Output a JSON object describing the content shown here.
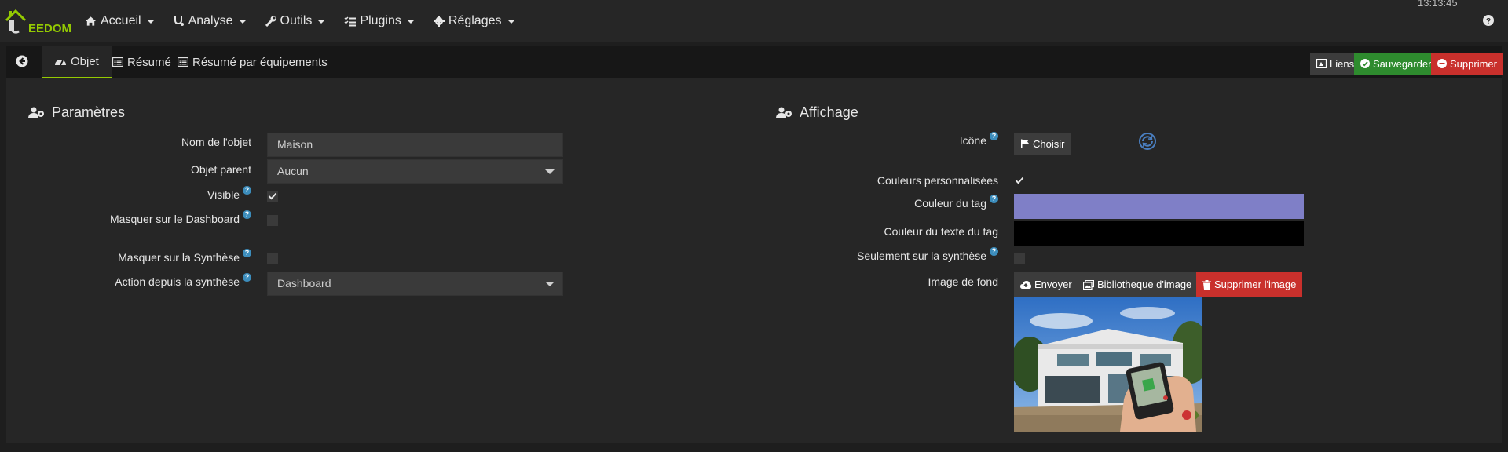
{
  "nav": {
    "logo_text": "EEDOM",
    "clock": "13:13:45",
    "items": [
      {
        "label": "Accueil",
        "icon": "home-icon"
      },
      {
        "label": "Analyse",
        "icon": "stethoscope-icon"
      },
      {
        "label": "Outils",
        "icon": "wrench-icon"
      },
      {
        "label": "Plugins",
        "icon": "tasks-icon"
      },
      {
        "label": "Réglages",
        "icon": "cog-icon"
      }
    ]
  },
  "tabs": {
    "objet": "Objet",
    "resume": "Résumé",
    "resume_equip": "Résumé par équipements"
  },
  "actions": {
    "liens": "Liens",
    "sauvegarder": "Sauvegarder",
    "supprimer": "Supprimer"
  },
  "params": {
    "title": "Paramètres",
    "nom_label": "Nom de l'objet",
    "nom_value": "Maison",
    "parent_label": "Objet parent",
    "parent_value": "Aucun",
    "visible_label": "Visible",
    "visible_checked": true,
    "masquer_dashboard_label": "Masquer sur le Dashboard",
    "masquer_dashboard_checked": false,
    "masquer_synthese_label": "Masquer sur la Synthèse",
    "masquer_synthese_checked": false,
    "action_label": "Action depuis la synthèse",
    "action_value": "Dashboard"
  },
  "affichage": {
    "title": "Affichage",
    "icone_label": "Icône",
    "choisir_label": "Choisir",
    "couleurs_label": "Couleurs personnalisées",
    "couleurs_checked": true,
    "couleur_tag_label": "Couleur du tag",
    "couleur_tag_value": "#7f7fc7",
    "couleur_texte_label": "Couleur du texte du tag",
    "couleur_texte_value": "#000000",
    "seulement_label": "Seulement sur la synthèse",
    "seulement_checked": false,
    "image_label": "Image de fond",
    "envoyer_label": "Envoyer",
    "bibliotheque_label": "Bibliotheque d'image",
    "supprimer_image_label": "Supprimer l'image"
  },
  "colors": {
    "accent": "#94ca02",
    "success": "#2e8b2e",
    "danger": "#c9302c",
    "info": "#3c8dbc"
  }
}
